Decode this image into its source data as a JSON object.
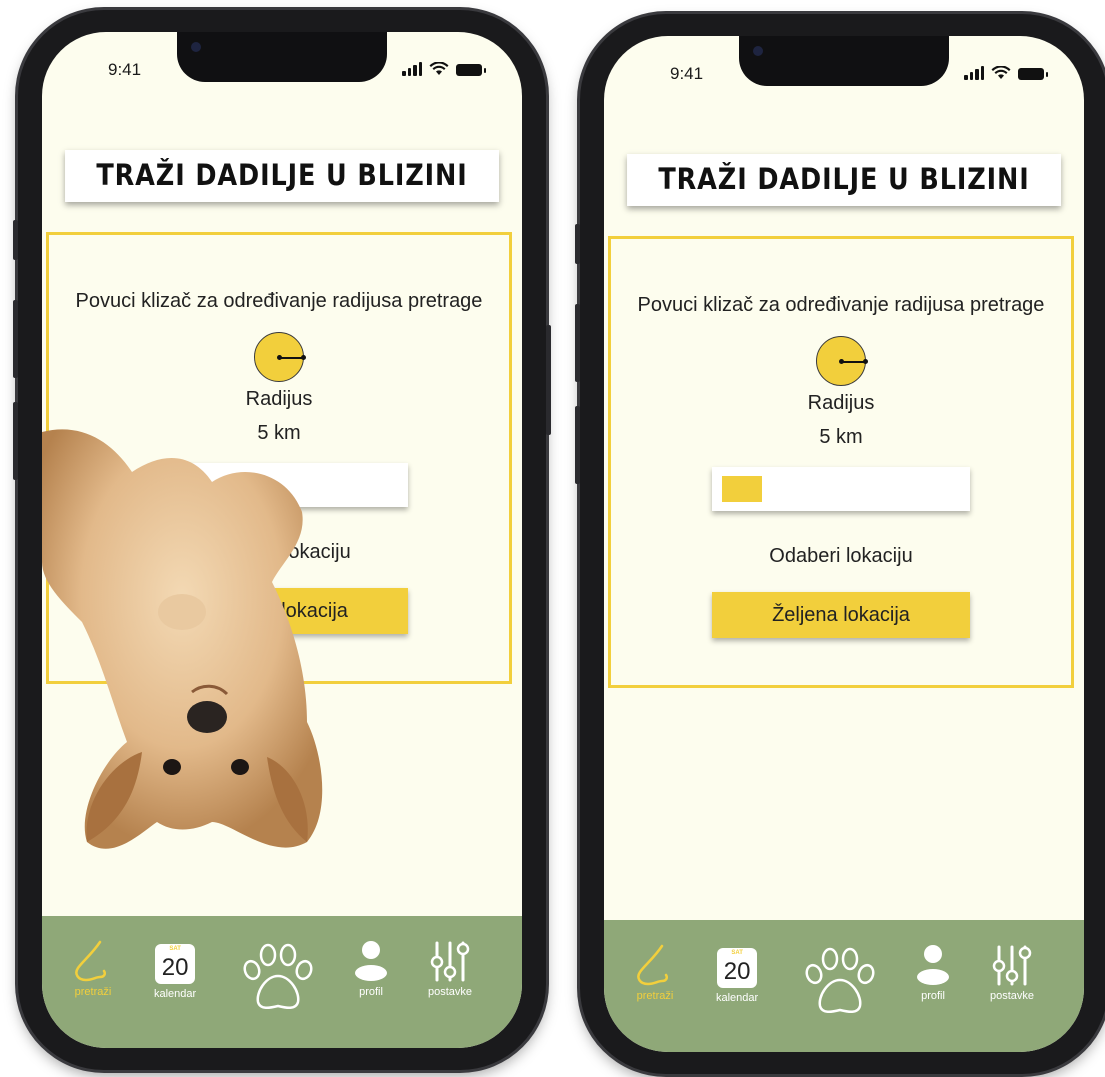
{
  "phones": [
    {
      "status_time": "9:41",
      "title": "TRAŽI DADILJE U BLIZINI",
      "instruction": "Povuci klizač za određivanje radijusa pretrage",
      "radius_label": "Radijus",
      "radius_value": "5 km",
      "slider_fraction": 0.17,
      "location_label": "Odaberi lokaciju",
      "location_button": "Željena lokacija",
      "nav": {
        "search": "pretraži",
        "calendar": "kalendar",
        "calendar_month": "SAT",
        "calendar_day": "20",
        "profile": "profil",
        "settings": "postavke"
      }
    },
    {
      "status_time": "9:41",
      "title": "TRAŽI DADILJE U BLIZINI",
      "instruction": "Povuci klizač za određivanje radijusa pretrage",
      "radius_label": "Radijus",
      "radius_value": "5 km",
      "slider_fraction": 0.17,
      "location_label": "Odaberi lokaciju",
      "location_button": "Željena lokacija",
      "nav": {
        "search": "pretraži",
        "calendar": "kalendar",
        "calendar_month": "SAT",
        "calendar_day": "20",
        "profile": "profil",
        "settings": "postavke"
      }
    }
  ],
  "colors": {
    "accent": "#f2cf3c",
    "screen_bg": "#fdfdee",
    "navbar": "#8fa878"
  },
  "icons": {
    "search": "nose-icon",
    "calendar": "calendar-icon",
    "center": "paw-icon",
    "profile": "person-icon",
    "settings": "sliders-icon"
  }
}
